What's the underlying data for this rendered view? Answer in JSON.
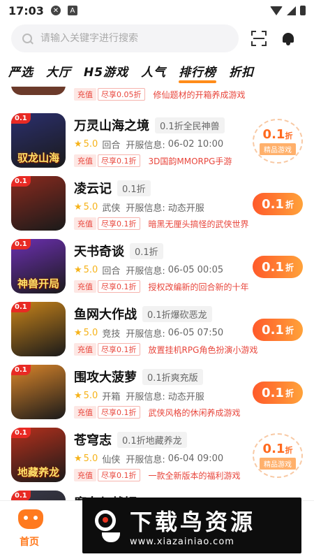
{
  "status_bar": {
    "time": "17:03"
  },
  "search": {
    "placeholder": "请输入关键字进行搜索"
  },
  "tabs": [
    "严选",
    "大厅",
    "H5游戏",
    "人气",
    "排行榜",
    "折扣"
  ],
  "active_tab": "排行榜",
  "partial_top": {
    "promo1": "充值",
    "promo2": "尽享0.05折",
    "desc": "修仙题材的开箱养成游戏"
  },
  "games": [
    {
      "name": "万灵山海之境",
      "tag": "0.1折全民神兽",
      "rating": "5.0",
      "genre": "回合",
      "open_label": "开服信息:",
      "open_info": "06-02 10:00",
      "promo1": "充值",
      "promo2": "尽享0.1折",
      "desc": "3D国韵MMORPG手游",
      "thumb_badge": "0.1",
      "thumb_caption": "驭龙山海",
      "button_value": "0.1",
      "button_unit": "折",
      "seal_label": "精品游戏",
      "button_style": "seal",
      "thumb_color": "#2b2f6e"
    },
    {
      "name": "凌云记",
      "tag": "0.1折",
      "rating": "5.0",
      "genre": "武侠",
      "open_label": "开服信息:",
      "open_info": "动态开服",
      "promo1": "充值",
      "promo2": "尽享0.1折",
      "desc": "暗黑无厘头搞怪的武侠世界",
      "thumb_badge": "0.1",
      "thumb_caption": "",
      "button_value": "0.1",
      "button_unit": "折",
      "button_style": "pill",
      "thumb_color": "#8a2a1e"
    },
    {
      "name": "天书奇谈",
      "tag": "0.1折",
      "rating": "5.0",
      "genre": "回合",
      "open_label": "开服信息:",
      "open_info": "06-05 00:05",
      "promo1": "充值",
      "promo2": "尽享0.1折",
      "desc": "授权改编新的回合新的十年",
      "thumb_badge": "0.1",
      "thumb_caption": "神兽开局",
      "button_value": "0.1",
      "button_unit": "折",
      "button_style": "pill",
      "thumb_color": "#6b2fb0"
    },
    {
      "name": "鱼网大作战",
      "tag": "0.1折爆砍恶龙",
      "rating": "5.0",
      "genre": "竞技",
      "open_label": "开服信息:",
      "open_info": "06-05 07:50",
      "promo1": "充值",
      "promo2": "尽享0.1折",
      "desc": "放置挂机RPG角色扮演小游戏",
      "thumb_badge": "0.1",
      "thumb_caption": "",
      "button_value": "0.1",
      "button_unit": "折",
      "button_style": "pill",
      "thumb_color": "#c7831a"
    },
    {
      "name": "围攻大菠萝",
      "tag": "0.1折爽充版",
      "rating": "5.0",
      "genre": "开箱",
      "open_label": "开服信息:",
      "open_info": "动态开服",
      "promo1": "充值",
      "promo2": "尽享0.1折",
      "desc": "武侠风格的休闲养成游戏",
      "thumb_badge": "0.1",
      "thumb_caption": "",
      "button_value": "0.1",
      "button_unit": "折",
      "button_style": "pill",
      "thumb_color": "#d9852a"
    },
    {
      "name": "苍穹志",
      "tag": "0.1折地藏养龙",
      "rating": "5.0",
      "genre": "仙侠",
      "open_label": "开服信息:",
      "open_info": "06-04 09:00",
      "promo1": "充值",
      "promo2": "尽享0.1折",
      "desc": "一款全新版本的福利游戏",
      "thumb_badge": "0.1",
      "thumb_caption": "地藏养龙",
      "button_value": "0.1",
      "button_unit": "折",
      "seal_label": "精品游戏",
      "button_style": "seal",
      "thumb_color": "#b5301c"
    },
    {
      "name": "魔女与战姬",
      "tag": "",
      "rating": "",
      "genre": "",
      "thumb_badge": "0.1",
      "thumb_caption": "",
      "button_style": "none",
      "thumb_color": "#3a3a4a"
    }
  ],
  "bottom_nav": {
    "home_label": "首页"
  },
  "watermark": {
    "title": "下载鸟资源",
    "url": "www.xiazainiao.com"
  }
}
